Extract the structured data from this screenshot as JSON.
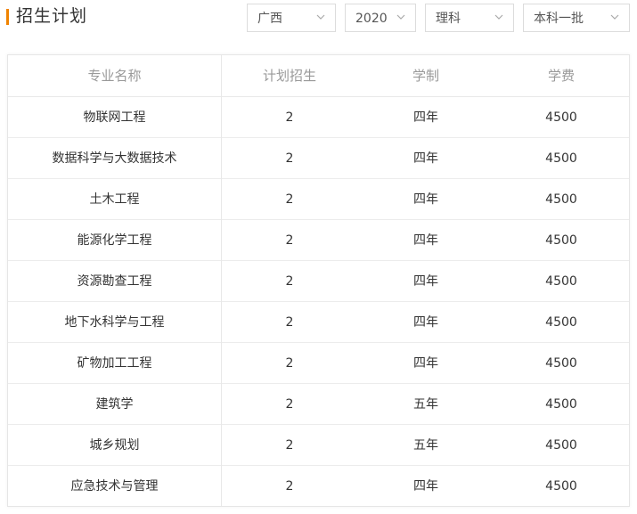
{
  "header": {
    "title": "招生计划"
  },
  "filters": {
    "province": "广西",
    "year": "2020",
    "subject": "理科",
    "batch": "本科一批"
  },
  "table": {
    "columns": [
      "专业名称",
      "计划招生",
      "学制",
      "学费"
    ],
    "rows": [
      {
        "major": "物联网工程",
        "plan": "2",
        "duration": "四年",
        "fee": "4500"
      },
      {
        "major": "数据科学与大数据技术",
        "plan": "2",
        "duration": "四年",
        "fee": "4500"
      },
      {
        "major": "土木工程",
        "plan": "2",
        "duration": "四年",
        "fee": "4500"
      },
      {
        "major": "能源化学工程",
        "plan": "2",
        "duration": "四年",
        "fee": "4500"
      },
      {
        "major": "资源勘查工程",
        "plan": "2",
        "duration": "四年",
        "fee": "4500"
      },
      {
        "major": "地下水科学与工程",
        "plan": "2",
        "duration": "四年",
        "fee": "4500"
      },
      {
        "major": "矿物加工工程",
        "plan": "2",
        "duration": "四年",
        "fee": "4500"
      },
      {
        "major": "建筑学",
        "plan": "2",
        "duration": "五年",
        "fee": "4500"
      },
      {
        "major": "城乡规划",
        "plan": "2",
        "duration": "五年",
        "fee": "4500"
      },
      {
        "major": "应急技术与管理",
        "plan": "2",
        "duration": "四年",
        "fee": "4500"
      }
    ]
  },
  "colors": {
    "accent": "#f08300"
  }
}
